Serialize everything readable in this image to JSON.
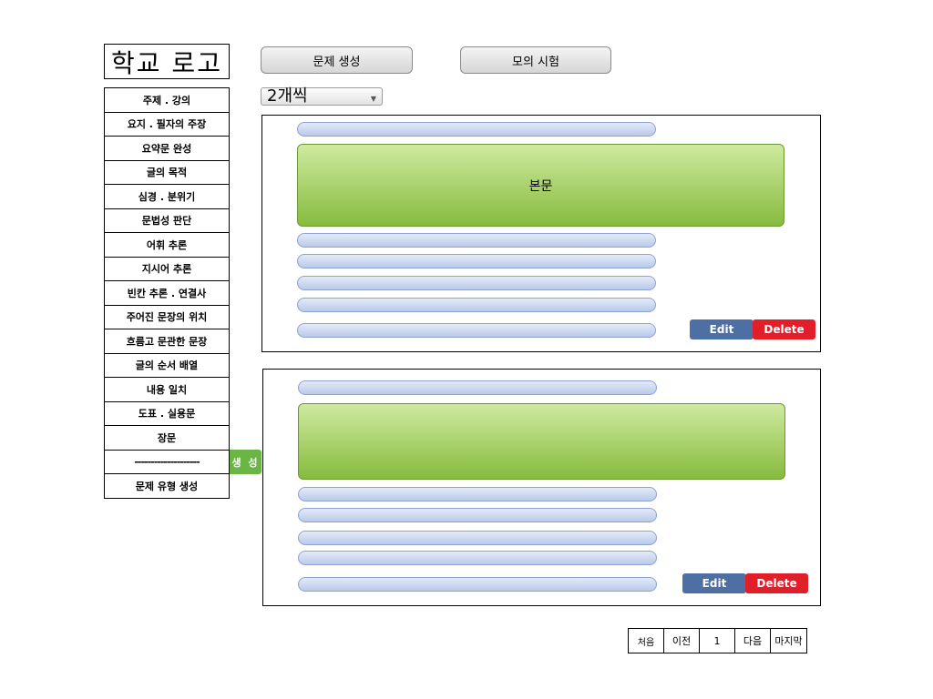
{
  "logo": "학교 로고",
  "top_buttons": {
    "create": "문제 생성",
    "mock_exam": "모의 시험"
  },
  "count_select": {
    "value": "2개씩",
    "arrow_icon": "chevron-down-icon"
  },
  "sidebar": {
    "items": [
      "주제 . 강의",
      "요지 . 필자의 주장",
      "요약문 완성",
      "글의 목적",
      "심경 . 분위기",
      "문법성 판단",
      "어휘 추론",
      "지시어 추론",
      "빈칸 추론 . 연결사",
      "주어진 문장의 위치",
      "흐름고 문관한 문장",
      "글의 순서 배열",
      "내용 일치",
      "도표 . 실용문",
      "장문",
      "--------------------",
      "문제 유형 생성"
    ],
    "generate_label": "생 성"
  },
  "cards": [
    {
      "passage_label": "본문",
      "edit_label": "Edit",
      "delete_label": "Delete"
    },
    {
      "passage_label": "",
      "edit_label": "Edit",
      "delete_label": "Delete"
    }
  ],
  "pagination": {
    "first": "처음",
    "prev": "이전",
    "current": "1",
    "next": "다음",
    "last": "마지막"
  },
  "colors": {
    "passage_green": "#86bb3e",
    "bar_blue": "#b9c9e9",
    "edit_blue": "#4e6fa3",
    "delete_red": "#e01f2a",
    "generate_green": "#6bb544"
  }
}
